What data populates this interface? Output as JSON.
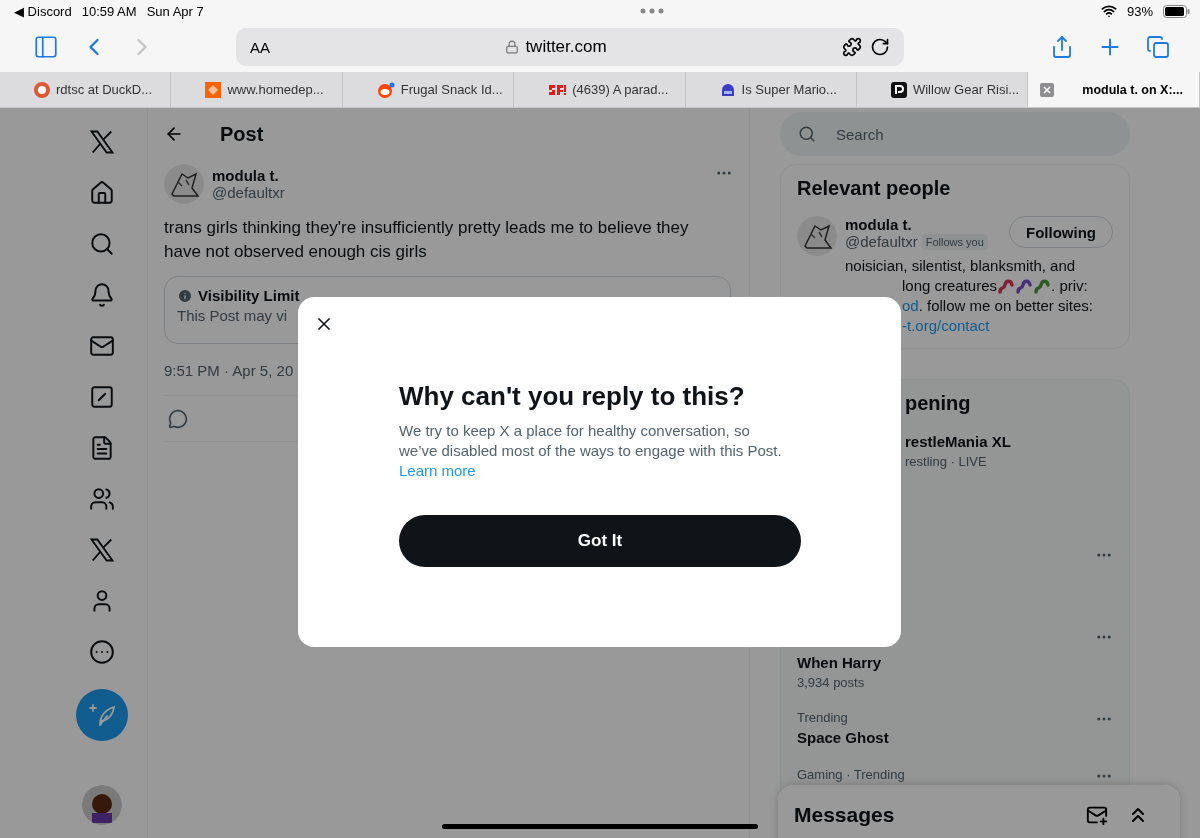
{
  "status_bar": {
    "back_app": "◀ Discord",
    "time": "10:59 AM",
    "date": "Sun Apr 7",
    "battery": "93%"
  },
  "toolbar": {
    "text_size": "AA",
    "url": "twitter.com"
  },
  "tabs": [
    {
      "title": "rdtsc at DuckD...",
      "kind": "duck",
      "selected": false
    },
    {
      "title": "www.homedep...",
      "kind": "orange",
      "selected": false
    },
    {
      "title": "Frugal Snack Id...",
      "kind": "reddit",
      "selected": false
    },
    {
      "title": "(4639) A parad...",
      "kind": "sf",
      "selected": false
    },
    {
      "title": "Is Super Mario...",
      "kind": "blue",
      "selected": false
    },
    {
      "title": "Willow Gear Risi...",
      "kind": "dark",
      "selected": false
    },
    {
      "title": "modula t. on X:...",
      "kind": "close",
      "selected": true
    }
  ],
  "nav": [
    {
      "kind": "logo"
    },
    {
      "kind": "home"
    },
    {
      "kind": "search"
    },
    {
      "kind": "bell"
    },
    {
      "kind": "mail"
    },
    {
      "kind": "slash"
    },
    {
      "kind": "list"
    },
    {
      "kind": "people"
    },
    {
      "kind": "logo"
    },
    {
      "kind": "person"
    },
    {
      "kind": "more"
    }
  ],
  "post": {
    "header": "Post",
    "author": "modula t.",
    "handle": "@defaultxr",
    "text": "trans girls thinking they're insufficiently pretty leads me to believe they have not observed enough cis girls",
    "notice_title": "Visibility Limit",
    "notice_text": "This Post may vi",
    "timestamp": "9:51 PM · Apr 5, 20"
  },
  "sidebar": {
    "search_placeholder": "Search",
    "relevant": {
      "title": "Relevant people",
      "name": "modula t.",
      "handle": "@defaultxr",
      "follows_you": "Follows you",
      "button": "Following",
      "bio_first": "noisician, silentist, blanksmith, and",
      "bio_second": "long creatures",
      "bio_second_end": ". priv:",
      "bio_link": "od",
      "bio_third": ". follow me on better sites:",
      "bio_fourth": "-t.org/contact"
    },
    "happening": {
      "title": "pening",
      "trends": [
        {
          "name": "restleMania XL",
          "meta": "restling · LIVE",
          "more": false
        },
        {
          "more": true
        },
        {
          "name": "When Harry",
          "meta": "3,934 posts",
          "more": true
        },
        {
          "category": "Trending",
          "name": "Space Ghost",
          "more": true
        },
        {
          "category": "Gaming · Trending",
          "more": true
        }
      ]
    }
  },
  "messages": {
    "title": "Messages"
  },
  "dialog": {
    "title": "Why can't you reply to this?",
    "body": "We try to keep X a place for healthy conversation, so we’ve disabled most of the ways to engage with this Post.",
    "link": "Learn more",
    "button": "Got It"
  }
}
